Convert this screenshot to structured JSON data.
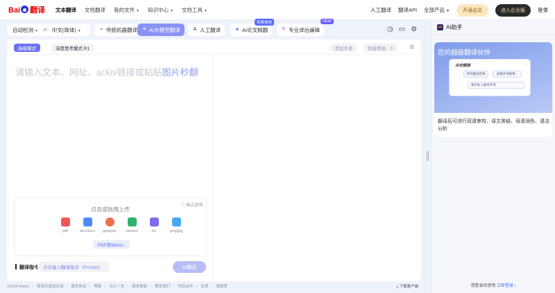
{
  "nav": {
    "logo_brand": "Bai",
    "logo_paw": "du",
    "logo_product": "翻译",
    "links": [
      "文本翻译",
      "文档翻译",
      "我的文件",
      "知识中心",
      "文档工具"
    ],
    "right": [
      "人工翻译",
      "翻译API",
      "全部产品"
    ],
    "vip": "开通会员",
    "enterprise": "进入企业版",
    "login": "登录"
  },
  "toolbar": {
    "source_lang": "自动检测",
    "swap": "⇄",
    "target_lang": "中文(简体)",
    "modes": [
      "传统机器翻译",
      "AI大模型翻译",
      "人工翻译",
      "AI论文精翻",
      "专业译后编辑"
    ],
    "tag_free": "免费体验",
    "tag_new": "NEW"
  },
  "editor": {
    "mode_high": "高级模式",
    "mode_deep": "深度思考模式 R1",
    "add_term": "添加术语",
    "enhance": "智能增强 · ⊙",
    "placeholder": "请输入文本、网址、arXiv链接或粘贴",
    "placeholder_link": "图片秒翻",
    "format_help": "ⓘ 格式说明",
    "upload_title": "点击或拖拽上传",
    "files": [
      "pdf",
      "doc/docx",
      "ppt/pptx",
      "xls/xlsx",
      "txt",
      "png/jpg"
    ],
    "file_colors": [
      "#f25656",
      "#4a8cf7",
      "#f26d4d",
      "#2fb36b",
      "#7b6cf0",
      "#4aa7f2"
    ],
    "pdf_convert": "PDF转Word ›",
    "prompt_label": "翻译指令",
    "prompt_placeholder": "点击输入翻译指令（Prompt）",
    "ai_button": "AI翻译"
  },
  "footer": {
    "links": [
      "©2025 Baidu",
      "使用百度前必读",
      "服务协议",
      "帮助",
      "文心一言",
      "版本更新",
      "联系我们",
      "代码合作",
      "反馈",
      "满意度"
    ],
    "download": "下载客户端"
  },
  "assistant": {
    "title": "AI助手",
    "card_title": "您的超级翻译伙伴",
    "mock_title": "点击链接",
    "chip1": "审校翻译结果",
    "chip2": "关键术语解释...",
    "row": "我的私人翻译专家",
    "desc": "翻译后可进行双语审校、译文答疑、母语润色、语法分析",
    "foot_text": "请登录后使用",
    "foot_link": "立即登录 ›"
  }
}
